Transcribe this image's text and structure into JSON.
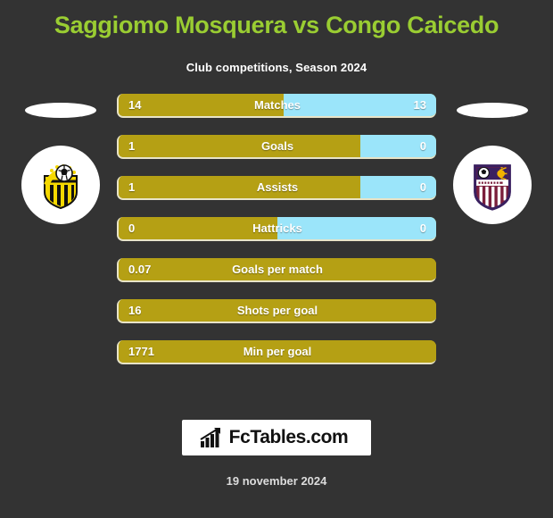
{
  "header": {
    "title": "Saggiomo Mosquera vs Congo Caicedo",
    "subtitle": "Club competitions, Season 2024"
  },
  "teams": {
    "home": {
      "crest_name": "home-team-crest",
      "colors": {
        "primary": "#F5D800",
        "secondary": "#111111"
      }
    },
    "away": {
      "crest_name": "away-team-crest",
      "colors": {
        "primary": "#7B1E3C",
        "secondary": "#3A2060"
      }
    }
  },
  "theme": {
    "background": "#333333",
    "title_color": "#9ACD32",
    "home_bar": "#B5A014",
    "away_bar": "#9BE5FA",
    "bar_border": "#E8E4C8",
    "text": "#FFFFFF"
  },
  "stats": [
    {
      "label": "Matches",
      "home": "14",
      "away": "13",
      "home_pct": 52,
      "split": true
    },
    {
      "label": "Goals",
      "home": "1",
      "away": "0",
      "home_pct": 76,
      "split": true
    },
    {
      "label": "Assists",
      "home": "1",
      "away": "0",
      "home_pct": 76,
      "split": true
    },
    {
      "label": "Hattricks",
      "home": "0",
      "away": "0",
      "home_pct": 50,
      "split": true
    },
    {
      "label": "Goals per match",
      "home": "0.07",
      "away": "",
      "home_pct": 100,
      "split": false
    },
    {
      "label": "Shots per goal",
      "home": "16",
      "away": "",
      "home_pct": 100,
      "split": false
    },
    {
      "label": "Min per goal",
      "home": "1771",
      "away": "",
      "home_pct": 100,
      "split": false
    }
  ],
  "footer": {
    "brand": "FcTables.com",
    "brand_icon": "bar-chart-icon",
    "date": "19 november 2024"
  }
}
